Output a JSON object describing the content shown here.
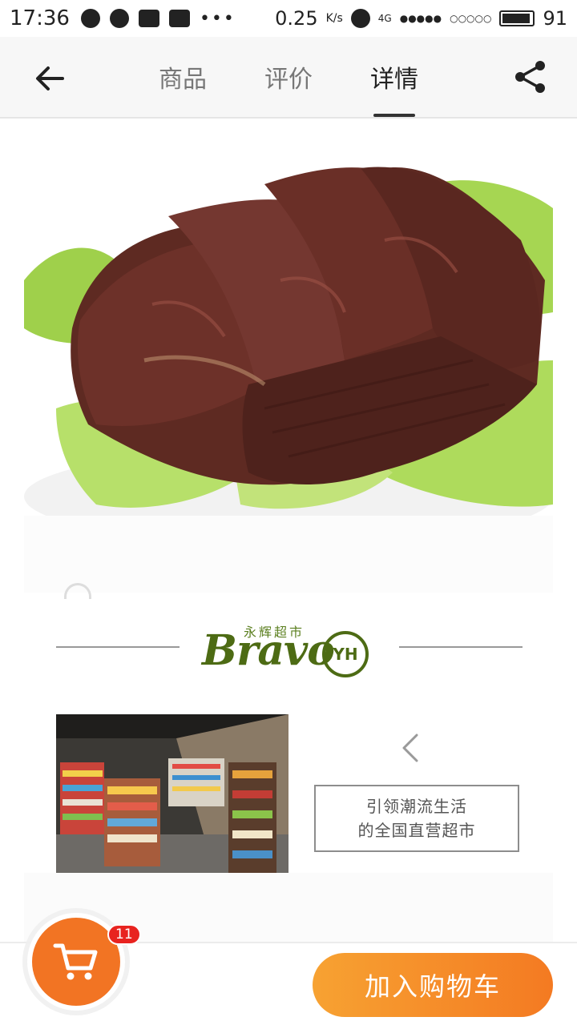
{
  "status_bar": {
    "time": "17:36",
    "net_speed": "0.25",
    "net_unit": "K/s",
    "signal": "4G",
    "battery_level": "91"
  },
  "nav": {
    "tabs": [
      {
        "label": "商品",
        "active": false
      },
      {
        "label": "评价",
        "active": false
      },
      {
        "label": "详情",
        "active": true
      }
    ]
  },
  "brand": {
    "name_cn": "永辉超市",
    "name_en": "Bravo",
    "badge": "YH"
  },
  "slogan": {
    "line1": "引领潮流生活",
    "line2": "的全国直营超市"
  },
  "bottom_bar": {
    "cart_count": "11",
    "add_to_cart_label": "加入购物车"
  },
  "colors": {
    "accent_orange": "#f27423",
    "button_gradient_start": "#f7a232",
    "button_gradient_end": "#f47a22",
    "badge_red": "#e8231f",
    "brand_green": "#4d6b14"
  }
}
